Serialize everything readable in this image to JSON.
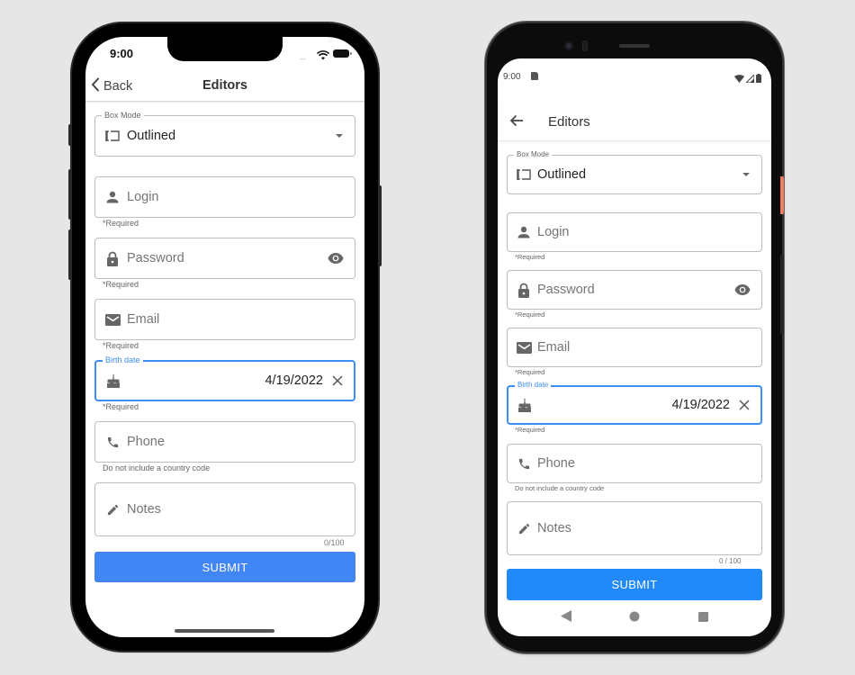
{
  "colors": {
    "accent": "#3b8ff4",
    "ios_submit": "#4285f4",
    "android_submit": "#2289fb",
    "android_power_button": "#f07d63"
  },
  "ios": {
    "status": {
      "time": "9:00",
      "signal_dots": "....",
      "wifi_icon": "wifi-icon",
      "battery_icon": "battery-icon"
    },
    "nav": {
      "back_label": "Back",
      "back_icon": "chevron-left-icon",
      "title": "Editors"
    },
    "form": {
      "box_mode": {
        "label": "Box Mode",
        "value": "Outlined",
        "icon": "box-mode-icon",
        "dropdown_icon": "dropdown-arrow-icon"
      },
      "login": {
        "placeholder": "Login",
        "icon": "person-icon",
        "help": "*Required"
      },
      "password": {
        "placeholder": "Password",
        "icon": "lock-icon",
        "toggle_icon": "eye-icon",
        "help": "*Required"
      },
      "email": {
        "placeholder": "Email",
        "icon": "mail-icon",
        "help": "*Required"
      },
      "birth_date": {
        "label": "Birth date",
        "value": "4/19/2022",
        "icon": "cake-icon",
        "clear_icon": "close-icon",
        "help": "*Required"
      },
      "phone": {
        "placeholder": "Phone",
        "icon": "phone-icon",
        "help": "Do not include a country code"
      },
      "notes": {
        "placeholder": "Notes",
        "icon": "pencil-icon",
        "counter": "0/100"
      },
      "submit_label": "SUBMIT"
    }
  },
  "android": {
    "status": {
      "time": "9:00",
      "sd_icon": "sd-card-icon",
      "wifi_icon": "wifi-icon",
      "signal_icon": "signal-icon",
      "battery_icon": "battery-icon"
    },
    "appbar": {
      "back_icon": "arrow-left-icon",
      "title": "Editors"
    },
    "form": {
      "box_mode": {
        "label": "Box Mode",
        "value": "Outlined",
        "icon": "box-mode-icon",
        "dropdown_icon": "dropdown-arrow-icon"
      },
      "login": {
        "placeholder": "Login",
        "icon": "person-icon",
        "help": "*Required"
      },
      "password": {
        "placeholder": "Password",
        "icon": "lock-icon",
        "toggle_icon": "eye-icon",
        "help": "*Required"
      },
      "email": {
        "placeholder": "Email",
        "icon": "mail-icon",
        "help": "*Required"
      },
      "birth_date": {
        "label": "Birth date",
        "value": "4/19/2022",
        "icon": "cake-icon",
        "clear_icon": "close-icon",
        "help": "*Required"
      },
      "phone": {
        "placeholder": "Phone",
        "icon": "phone-icon",
        "help": "Do not include a country code"
      },
      "notes": {
        "placeholder": "Notes",
        "icon": "pencil-icon",
        "counter": "0 / 100"
      },
      "submit_label": "SUBMIT"
    },
    "navbar": {
      "back": "back-triangle-icon",
      "home": "home-circle-icon",
      "recents": "recents-square-icon"
    }
  }
}
